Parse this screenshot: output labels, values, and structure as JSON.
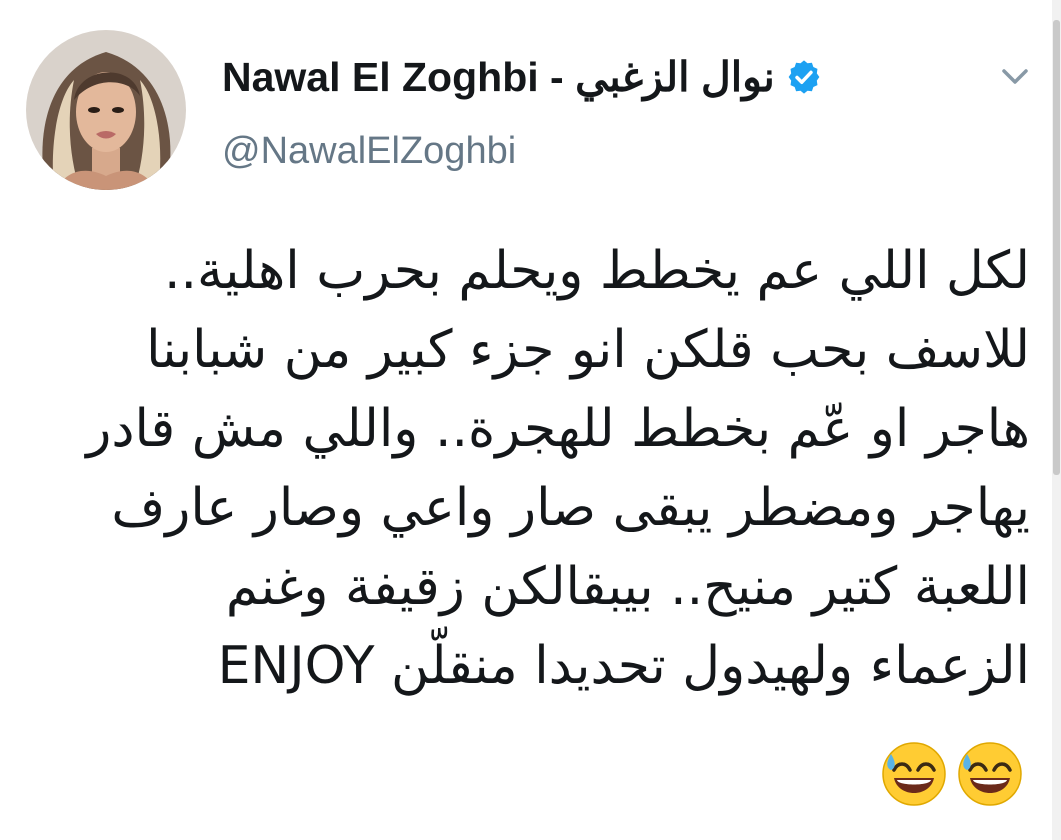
{
  "tweet": {
    "display_name": "Nawal El Zoghbi - نوال الزغبي",
    "handle": "@NawalElZoghbi",
    "verified": true,
    "lines": [
      "لكل اللي عم يخطط ويحلم بحرب اهلية..",
      "للاسف بحب قلكن انو جزء كبير من شبابنا",
      "هاجر او عّم بخطط للهجرة.. واللي مش قادر",
      "يهاجر ومضطر يبقى صار واعي وصار عارف",
      "اللعبة كتير منيح.. بيبقالكن زقيفة وغنم",
      "الزعماء ولهيدول تحديدا منقلّن ENJOY"
    ],
    "emojis": [
      "grinning-face-with-sweat",
      "grinning-face-with-sweat"
    ]
  },
  "colors": {
    "text": "#14171a",
    "secondary": "#657786",
    "verified_blue": "#1da1f2",
    "emoji_yellow": "#ffcc33"
  },
  "icons": {
    "verified": "verified-badge-icon",
    "more": "chevron-down-icon"
  }
}
